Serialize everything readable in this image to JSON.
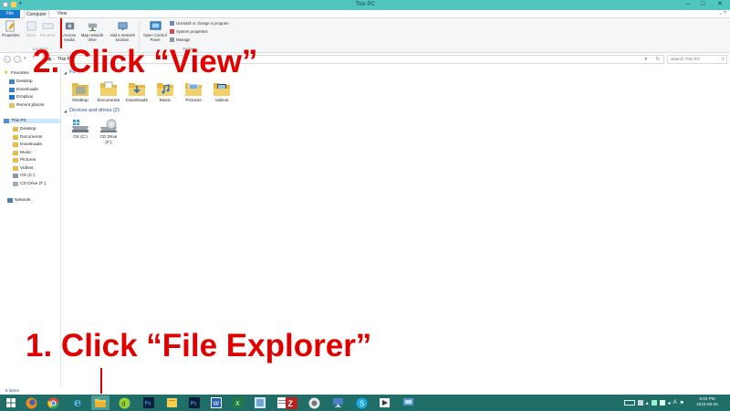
{
  "window": {
    "title": "This PC",
    "controls": [
      "–",
      "□",
      "✕"
    ]
  },
  "ribbon": {
    "tabs": [
      "File",
      "Computer",
      "View"
    ],
    "buttons": {
      "properties": "Properties",
      "open": "Open",
      "rename": "Rename",
      "access_media": "Access media",
      "map_network_drive": "Map network drive",
      "add_network_location": "Add a network location",
      "open_control_panel": "Open Control Panel"
    },
    "system_items": [
      "Uninstall or change a program",
      "System properties",
      "Manage"
    ],
    "group_labels": {
      "location": "Location",
      "system": "System"
    }
  },
  "address": {
    "path": "This PC",
    "search_placeholder": "Search This PC"
  },
  "nav": {
    "favorites_header": "Favorites",
    "favorites": [
      "Desktop",
      "Downloads",
      "Dropbox",
      "Recent places"
    ],
    "this_pc_header": "This PC",
    "this_pc_items": [
      "Desktop",
      "Documents",
      "Downloads",
      "Music",
      "Pictures",
      "Videos",
      "OS (C:)",
      "CD Drive (F:)"
    ],
    "network": "Network"
  },
  "content": {
    "folders_header": "Fo",
    "folders": [
      "Desktop",
      "Documents",
      "Downloads",
      "Music",
      "Pictures",
      "Videos"
    ],
    "devices_header": "Devices and drives (2)",
    "drives": [
      {
        "name": "OS (C:)"
      },
      {
        "name": "CD Drive",
        "sub": "(F:)"
      }
    ]
  },
  "status": {
    "items": "8 items"
  },
  "taskbar": {
    "icons": [
      "start-icon",
      "firefox-icon",
      "chrome-icon",
      "ie-icon",
      "file-explorer-icon",
      "dreamweaver-icon",
      "photoshop-icon",
      "sticky-icon",
      "photoshop2-icon",
      "ie2-icon",
      "word-icon",
      "excel-icon",
      "publisher-icon",
      "notepad-icon",
      "filezilla-icon",
      "snip-icon",
      "monitor-icon",
      "skype-icon",
      "media-icon",
      "network-icon"
    ],
    "time": "5:02 PM",
    "date": "2015-09-25"
  },
  "annotations": {
    "step1": "1. Click “File Explorer”",
    "step2": "2. Click “View”"
  },
  "colors": {
    "titlebar": "#4fc6bf",
    "taskbar": "#1f6e68",
    "file_tab": "#1979ca",
    "annotation": "#e00000"
  }
}
